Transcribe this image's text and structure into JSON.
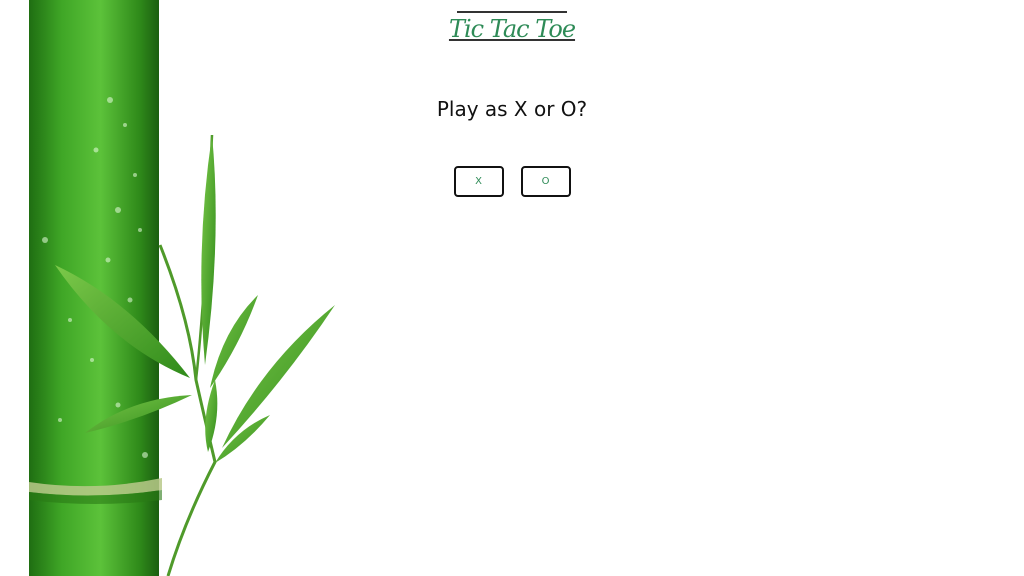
{
  "header": {
    "title": "Tic Tac Toe"
  },
  "prompt": {
    "text": "Play as X or O?"
  },
  "choices": {
    "x_label": "X",
    "o_label": "O"
  },
  "colors": {
    "accent": "#2e8b57",
    "text": "#111111",
    "bamboo": "#3a9a1e"
  }
}
